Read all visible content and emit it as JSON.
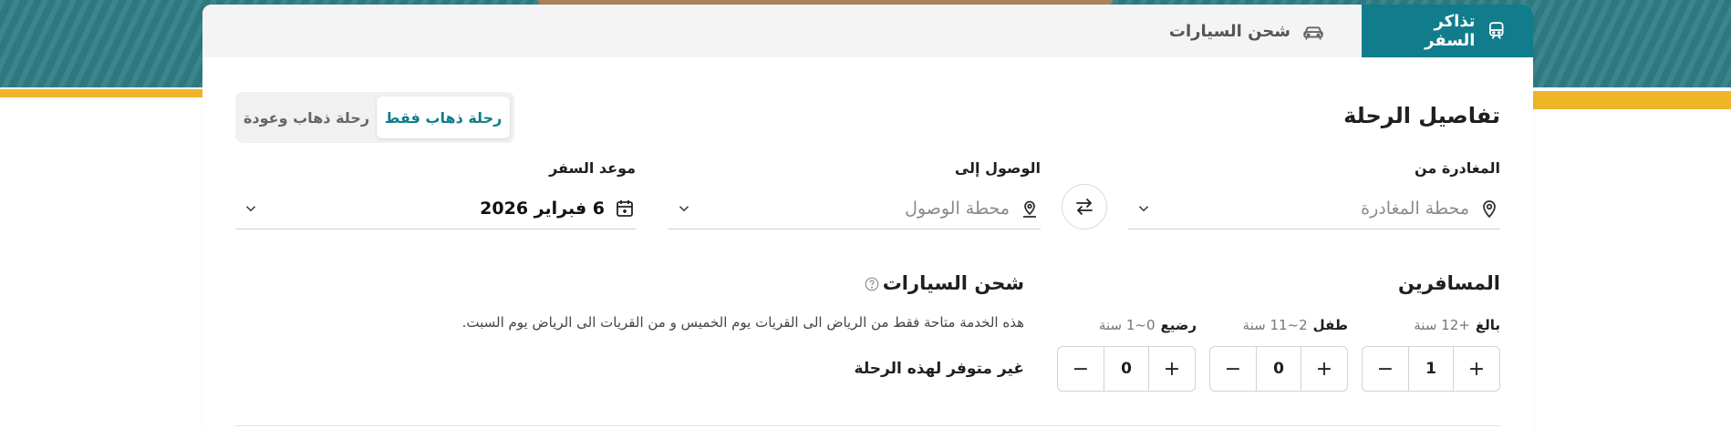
{
  "tabs": {
    "tickets_label": "تذاكر السفر",
    "cars_label": "شحن السيارات"
  },
  "trip": {
    "section_title": "تفاصيل الرحلة",
    "one_way_label": "رحلة ذهاب فقط",
    "round_trip_label": "رحلة ذهاب وعودة"
  },
  "departure": {
    "label": "المغادرة من",
    "placeholder": "محطة المغادرة"
  },
  "arrival": {
    "label": "الوصول إلى",
    "placeholder": "محطة الوصول"
  },
  "date": {
    "label": "موعد السفر",
    "value": "6 فبراير 2026"
  },
  "passengers": {
    "title": "المسافرين",
    "adult": {
      "label": "بالغ",
      "age": "+12 سنة",
      "count": "1"
    },
    "child": {
      "label": "طفل",
      "age": "2~11 سنة",
      "count": "0"
    },
    "infant": {
      "label": "رضيع",
      "age": "0~1 سنة",
      "count": "0"
    }
  },
  "car_shipping": {
    "title": "شحن السيارات",
    "note": "هذه الخدمة متاحة فقط من الرياض الى القريات يوم الخميس و من القريات الى الرياض يوم السبت.",
    "unavailable": "غير متوفر لهذه الرحلة"
  },
  "colors": {
    "accent": "#107c8c",
    "banner": "#2f7f86",
    "yellow": "#f0b429"
  }
}
